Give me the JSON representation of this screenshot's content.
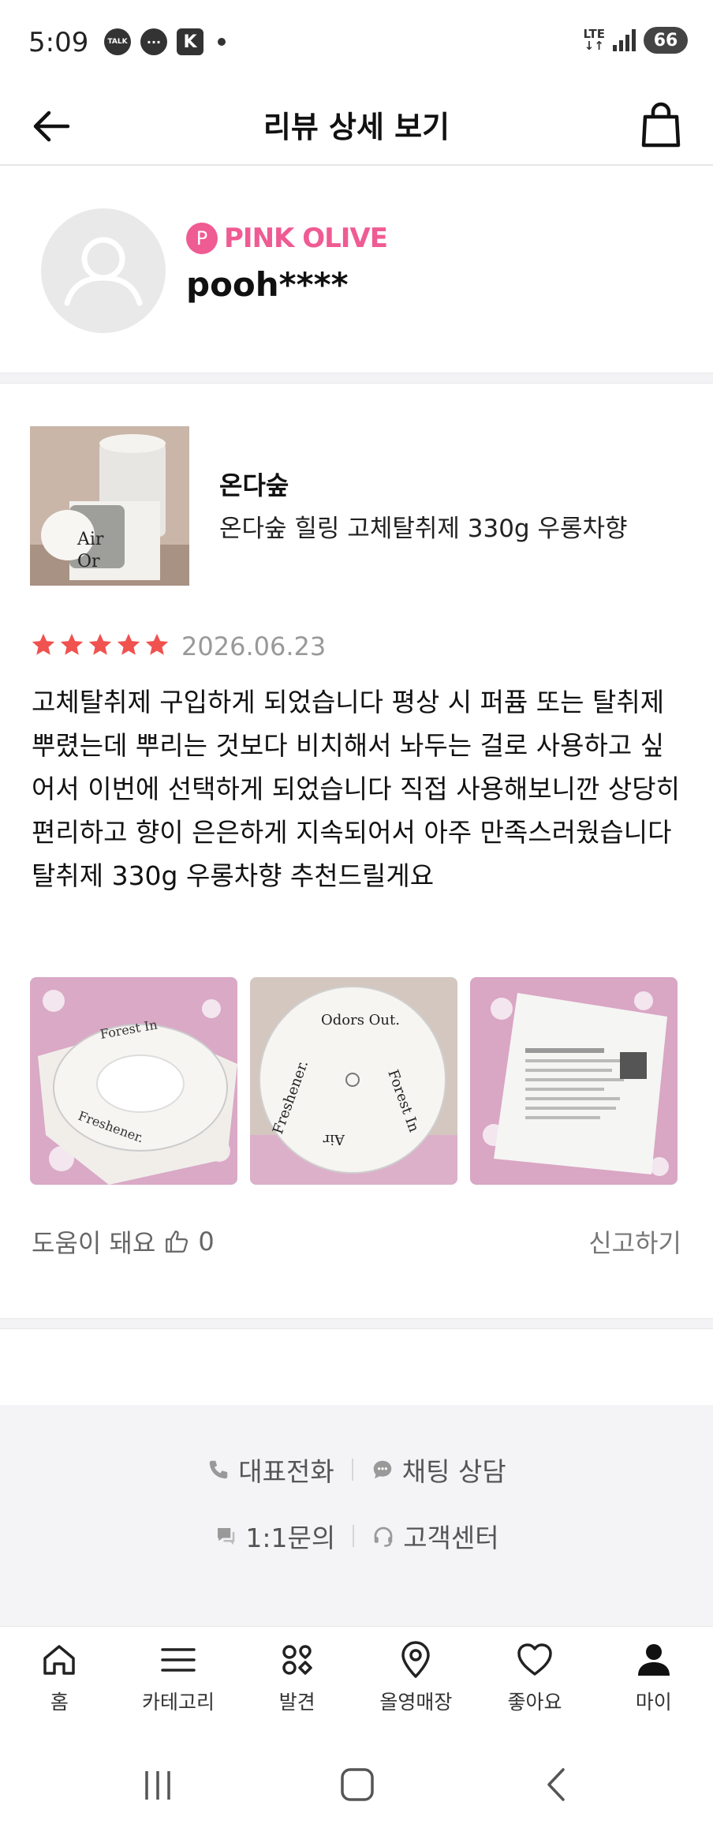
{
  "status_bar": {
    "time": "5:09",
    "notifications": [
      "TALK",
      "···",
      "K"
    ],
    "network": "LTE",
    "battery": "66"
  },
  "header": {
    "title": "리뷰 상세 보기",
    "back_icon": "arrow-left-icon",
    "cart_icon": "shopping-bag-icon"
  },
  "reviewer": {
    "badge_letter": "P",
    "grade": "PINK OLIVE",
    "username": "pooh****"
  },
  "product": {
    "brand": "온다숲",
    "name": "온다숲 힐링 고체탈취제 330g 우롱차향"
  },
  "review": {
    "rating": 5,
    "date": "2026.06.23",
    "text": "고체탈취제 구입하게 되었습니다 평상 시 퍼퓸 또는 탈취제 뿌렸는데 뿌리는 것보다 비치해서 놔두는 걸로 사용하고 싶어서 이번에 선택하게 되었습니다 직접 사용해보니깐 상당히 편리하고 향이 은은하게 지속되어서 아주 만족스러웠습니다 탈취제 330g 우롱차향 추천드릴게요",
    "photos": [
      "photo-1",
      "photo-2",
      "photo-3"
    ],
    "helpful_label": "도움이 돼요",
    "helpful_count": "0",
    "report_label": "신고하기"
  },
  "footer": {
    "phone": "대표전화",
    "chat": "채팅 상담",
    "inquiry": "1:1문의",
    "service": "고객센터"
  },
  "bottom_nav": [
    {
      "label": "홈",
      "icon": "home-icon"
    },
    {
      "label": "카테고리",
      "icon": "menu-icon"
    },
    {
      "label": "발견",
      "icon": "discover-icon"
    },
    {
      "label": "올영매장",
      "icon": "location-pin-icon"
    },
    {
      "label": "좋아요",
      "icon": "heart-icon"
    },
    {
      "label": "마이",
      "icon": "person-icon"
    }
  ],
  "colors": {
    "accent_pink": "#ef5b93",
    "star": "#f0524f"
  }
}
